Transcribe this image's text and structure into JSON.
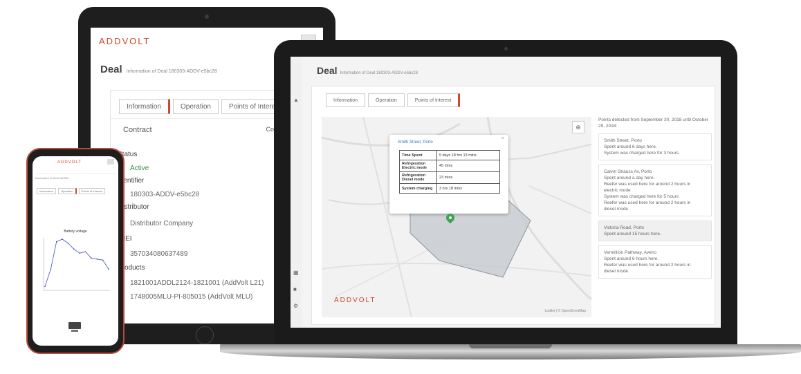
{
  "brand": {
    "logo": "ADDVOLT",
    "accent": "#d2462b",
    "connected": "#3fa34d",
    "link": "#2c7bbf"
  },
  "tablet": {
    "title": "Deal",
    "subtitle": "Information of Deal 180303-ADDV-e5bc28",
    "tabs": [
      "Information",
      "Operation",
      "Points of Interest"
    ],
    "active_tab": "Information",
    "contract_label": "Contract",
    "connection_label": "Connection",
    "fields": [
      {
        "label": "Status",
        "value": "Active"
      },
      {
        "label": "Identifier",
        "value": "180303-ADDV-e5bc28"
      },
      {
        "label": "Distributor",
        "value": "Distributor Company"
      },
      {
        "label": "IMEI",
        "value": "357034080637489"
      }
    ],
    "products_label": "Products",
    "products": [
      "1821001ADDL2124-1821001 (AddVolt L21)",
      "1748005MLU-PI-805015 (AddVolt MLU)"
    ]
  },
  "laptop": {
    "title": "Deal",
    "subtitle": "Information of Deal 180303-ADDV-e5bc28",
    "tabs": [
      "Information",
      "Operation",
      "Points of Interest"
    ],
    "active_tab": "Points of Interest",
    "sidebar_icons": [
      "home-icon",
      "grid-icon",
      "truck-icon",
      "gear-icon"
    ],
    "map": {
      "locate_icon": "crosshair-icon",
      "attribution": "Leaflet | © OpenStreetMap",
      "popup": {
        "title": "Smith Street, Porto",
        "close": "×",
        "rows": [
          {
            "key": "Time Spent",
            "value": "5 days 18 hrs 13 mins"
          },
          {
            "key": "Refrigeration Electric mode",
            "value": "45 mins"
          },
          {
            "key": "Refrigeration Diesel mode",
            "value": "23 mins"
          },
          {
            "key": "System charging",
            "value": "3 hrs 18 mins"
          }
        ]
      },
      "logo": "ADDVOLT"
    },
    "detected_text": "Points detected from September 30, 2018 until October 29, 2018:",
    "pois": [
      {
        "name": "Smith Street, Porto",
        "lines": [
          "Spent around 6 days here.",
          "System was charged here for 3 hours"
        ],
        "grey": false
      },
      {
        "name": "Calvin Strauss Av, Porto",
        "lines": [
          "Spent around a day here.",
          "Reefer was used here for around 2 hours in",
          "electric mode",
          "System was charged here for 5 hours",
          "Reefer was used here for around 2 hours in",
          "diesel mode"
        ],
        "grey": false
      },
      {
        "name": "Victoria Road, Porto",
        "lines": [
          "Spent around 15 hours here."
        ],
        "grey": true
      },
      {
        "name": "Vermillion Pathway, Aveiro",
        "lines": [
          "Spent around 6 hours here.",
          "Reefer was used here for around 2 hours in",
          "diesel mode"
        ],
        "grey": false
      }
    ]
  },
  "phone": {
    "logo": "ADDVOLT",
    "header_text": "Information of Deal 180303",
    "tabs": [
      "Information",
      "Operation",
      "Points of Interest"
    ],
    "active_tab": "Operation",
    "chart_data": {
      "type": "line",
      "title": "Battery voltage",
      "series": [
        {
          "values": [
            5,
            40,
            95,
            100,
            92,
            80,
            72,
            75,
            62,
            60,
            58,
            40
          ]
        }
      ],
      "ylim": [
        0,
        100
      ]
    }
  }
}
